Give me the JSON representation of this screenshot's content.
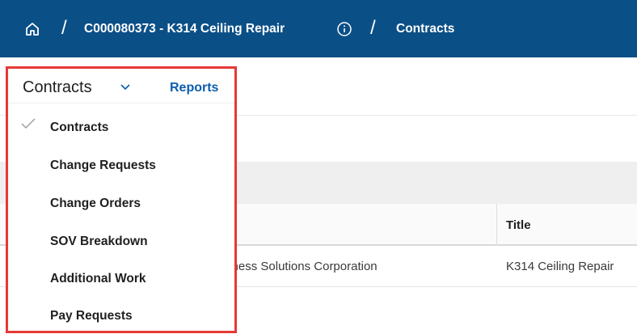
{
  "breadcrumb": {
    "project": "C000080373 - K314 Ceiling Repair",
    "current": "Contracts",
    "separator": "/"
  },
  "dropdown": {
    "selected_label": "Contracts",
    "reports_label": "Reports",
    "items": [
      {
        "label": "Contracts",
        "checked": true
      },
      {
        "label": "Change Requests",
        "checked": false
      },
      {
        "label": "Change Orders",
        "checked": false
      },
      {
        "label": "SOV Breakdown",
        "checked": false
      },
      {
        "label": "Additional Work",
        "checked": false
      },
      {
        "label": "Pay Requests",
        "checked": false
      }
    ]
  },
  "table": {
    "headers": {
      "title": "Title"
    },
    "rows": [
      {
        "company": "Atlantic Business Solutions Corporation",
        "title": "K314 Ceiling Repair"
      }
    ]
  },
  "colors": {
    "topbar": "#0b4f87",
    "highlight_border": "#e53935",
    "link": "#0b5cad"
  },
  "icons": [
    "home-icon",
    "info-icon",
    "chevron-down-icon",
    "check-icon"
  ]
}
